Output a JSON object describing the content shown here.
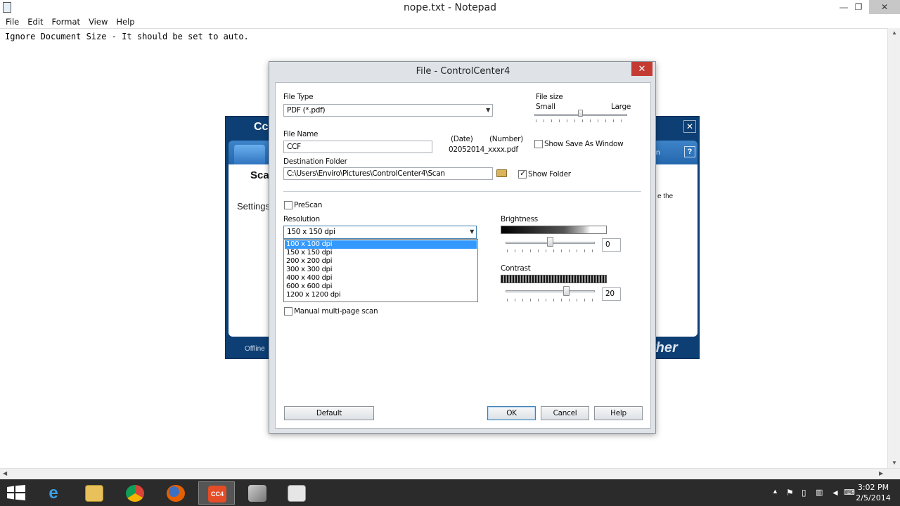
{
  "notepad": {
    "title": "nope.txt - Notepad",
    "menu": [
      "File",
      "Edit",
      "Format",
      "View",
      "Help"
    ],
    "content": "Ignore Document Size - It should be set to auto.",
    "controls": {
      "minimize": "—",
      "maximize": "❐",
      "close": "✕"
    }
  },
  "cc4_background": {
    "logo": "Cc",
    "scan_label": "Sca",
    "settings_label": "Settings",
    "status": "Offline",
    "brand": "ther",
    "partial_text": "e the",
    "partial_tab": "n",
    "help": "?",
    "close": "✕"
  },
  "dialog": {
    "title": "File - ControlCenter4",
    "close": "✕",
    "file_type_label": "File Type",
    "file_type_value": "PDF (*.pdf)",
    "file_size_label": "File size",
    "file_size_small": "Small",
    "file_size_large": "Large",
    "file_name_label": "File Name",
    "file_name_value": "CCF",
    "date_label": "(Date)",
    "number_label": "(Number)",
    "file_suffix": "02052014_xxxx.pdf",
    "show_save_as_label": "Show Save As Window",
    "show_save_as_checked": false,
    "destination_label": "Destination Folder",
    "destination_value": "C:\\Users\\Enviro\\Pictures\\ControlCenter4\\Scan",
    "show_folder_label": "Show Folder",
    "show_folder_checked": true,
    "prescan_label": "PreScan",
    "prescan_checked": false,
    "resolution_label": "Resolution",
    "resolution_value": "150 x 150 dpi",
    "resolution_options": [
      "100 x 100 dpi",
      "150 x 150 dpi",
      "200 x 200 dpi",
      "300 x 300 dpi",
      "400 x 400 dpi",
      "600 x 600 dpi",
      "1200 x 1200 dpi"
    ],
    "resolution_highlighted": "100 x 100 dpi",
    "manual_multipage_label": "Manual multi-page scan",
    "manual_multipage_checked": false,
    "brightness_label": "Brightness",
    "brightness_value": "0",
    "contrast_label": "Contrast",
    "contrast_value": "20",
    "buttons": {
      "default": "Default",
      "ok": "OK",
      "cancel": "Cancel",
      "help": "Help"
    }
  },
  "taskbar": {
    "apps": [
      "start",
      "internet-explorer",
      "file-explorer",
      "chrome",
      "firefox",
      "controlcenter4",
      "scanner",
      "notepad-window"
    ],
    "active_app": "controlcenter4",
    "cc4_badge": "CC4",
    "clock_time": "3:02 PM",
    "clock_date": "2/5/2014"
  },
  "colors": {
    "accent_selection": "#3399ff",
    "dialog_close": "#c43b33",
    "cc4_blue": "#0d3f74",
    "taskbar": "#2b2b2b"
  }
}
